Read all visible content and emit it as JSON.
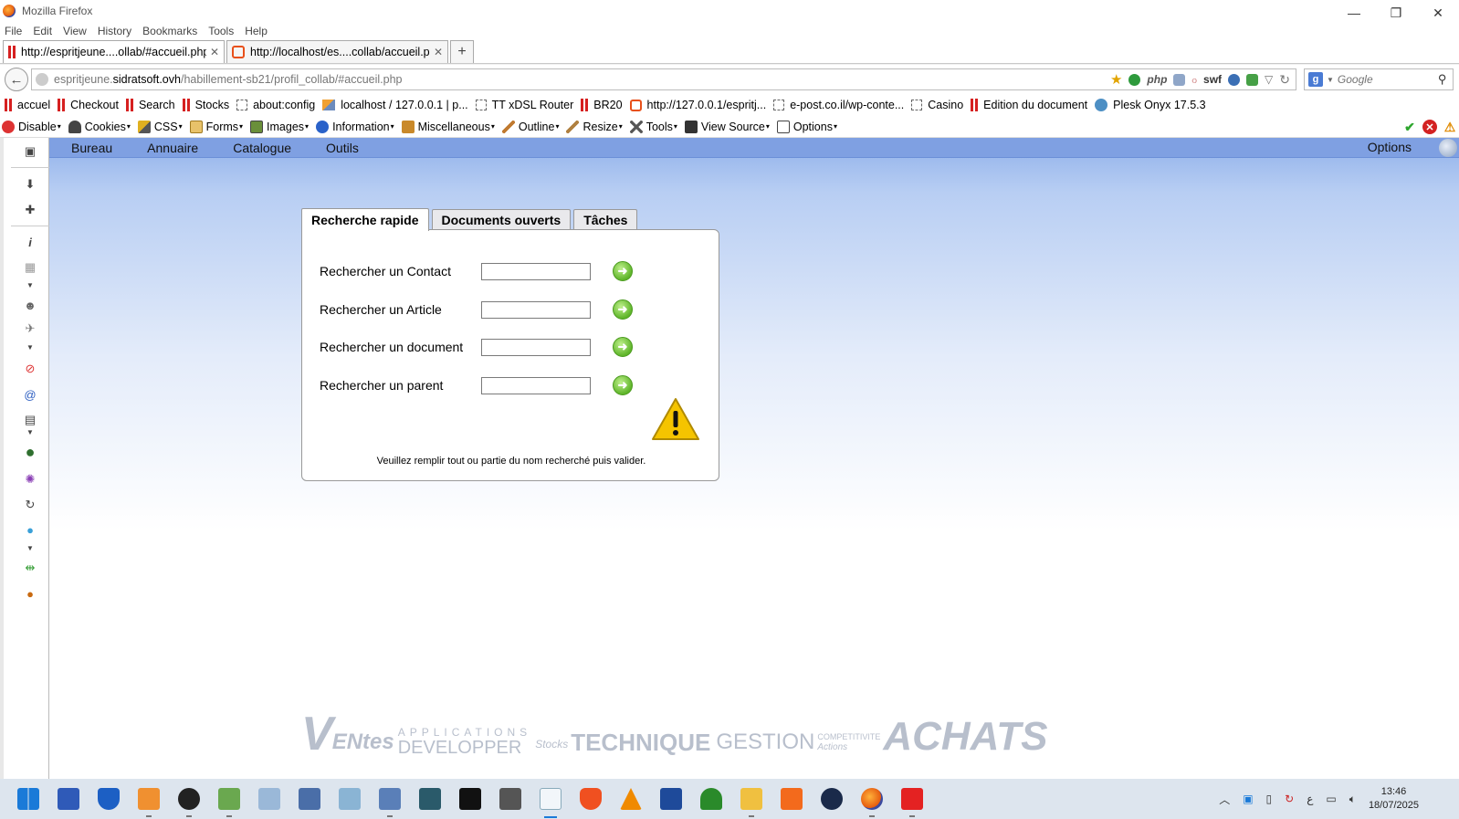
{
  "window": {
    "title": "Mozilla Firefox"
  },
  "menubar": [
    "File",
    "Edit",
    "View",
    "History",
    "Bookmarks",
    "Tools",
    "Help"
  ],
  "tabs": [
    {
      "title": "http://espritjeune....ollab/#accueil.php",
      "active": true
    },
    {
      "title": "http://localhost/es....collab/accueil.php",
      "active": false
    }
  ],
  "navbar": {
    "url_prefix": "espritjeune.",
    "url_domain": "sidratsoft.ovh",
    "url_path": "/habillement-sb21/profil_collab/#accueil.php",
    "url_icons": [
      "php",
      "swf"
    ],
    "search_placeholder": "Google"
  },
  "bookmarks": [
    {
      "label": "accuel",
      "icon": "red-bars-icon"
    },
    {
      "label": "Checkout",
      "icon": "red-bars-icon"
    },
    {
      "label": "Search",
      "icon": "red-bars-icon"
    },
    {
      "label": "Stocks",
      "icon": "red-bars-icon"
    },
    {
      "label": "about:config",
      "icon": "blank-page-icon"
    },
    {
      "label": "localhost / 127.0.0.1 | p...",
      "icon": "phpmyadmin-icon"
    },
    {
      "label": "TT xDSL Router",
      "icon": "blank-page-icon"
    },
    {
      "label": "BR20",
      "icon": "red-bars-icon"
    },
    {
      "label": "http://127.0.0.1/espritj...",
      "icon": "xampp-icon"
    },
    {
      "label": "e-post.co.il/wp-conte...",
      "icon": "blank-page-icon"
    },
    {
      "label": "Casino",
      "icon": "blank-page-icon"
    },
    {
      "label": "Edition du document",
      "icon": "red-bars-icon"
    },
    {
      "label": "Plesk Onyx 17.5.3",
      "icon": "plesk-icon"
    }
  ],
  "webdev_toolbar": [
    "Disable",
    "Cookies",
    "CSS",
    "Forms",
    "Images",
    "Information",
    "Miscellaneous",
    "Outline",
    "Resize",
    "Tools",
    "View Source",
    "Options"
  ],
  "app": {
    "menu": [
      "Bureau",
      "Annuaire",
      "Catalogue",
      "Outils"
    ],
    "options_label": "Options",
    "panel_tabs": [
      "Recherche rapide",
      "Documents ouverts",
      "Tâches"
    ],
    "search_rows": [
      {
        "label": "Rechercher un Contact",
        "value": ""
      },
      {
        "label": "Rechercher un Article",
        "value": ""
      },
      {
        "label": "Rechercher un document",
        "value": ""
      },
      {
        "label": "Rechercher un parent",
        "value": ""
      }
    ],
    "message": "Veuillez remplir tout ou partie du nom recherché puis valider.",
    "banner": {
      "v": "V",
      "entes": "ENtes",
      "applications": "APPLICATIONS",
      "developper": "DEVELOPPER",
      "stocks": "Stocks",
      "technique": "TECHNIQUE",
      "gestion": "GESTION",
      "competitivite": "COMPETITIVITE",
      "actions": "Actions",
      "achats": "ACHATS"
    }
  },
  "taskbar": {
    "time": "13:46",
    "date": "18/07/2025"
  },
  "colors": {
    "app_menu": "#7fa0e2",
    "go_button": "#5fb52a",
    "warning": "#f5c400"
  }
}
